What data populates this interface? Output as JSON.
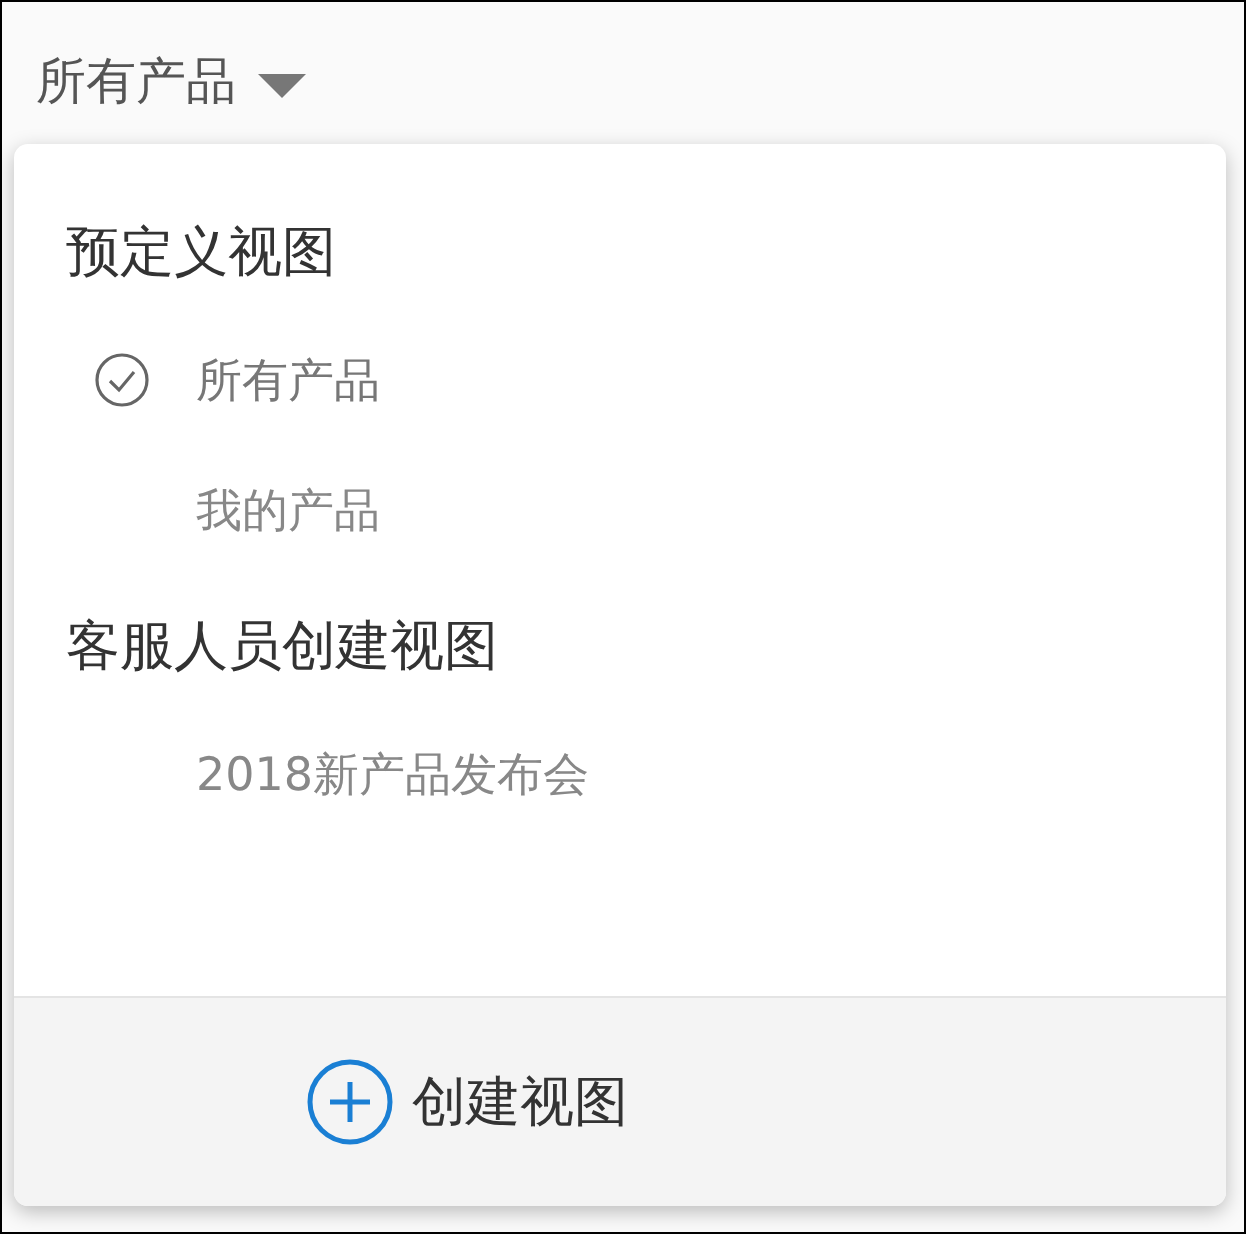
{
  "view_selector": {
    "label": "所有产品"
  },
  "menu": {
    "sections": [
      {
        "heading": "预定义视图",
        "items": [
          {
            "label": "所有产品",
            "selected": true
          },
          {
            "label": "我的产品",
            "selected": false
          }
        ]
      },
      {
        "heading": "客服人员创建视图",
        "items": [
          {
            "label": "2018新产品发布会",
            "selected": false
          }
        ]
      }
    ],
    "footer_button": "创建视图"
  }
}
